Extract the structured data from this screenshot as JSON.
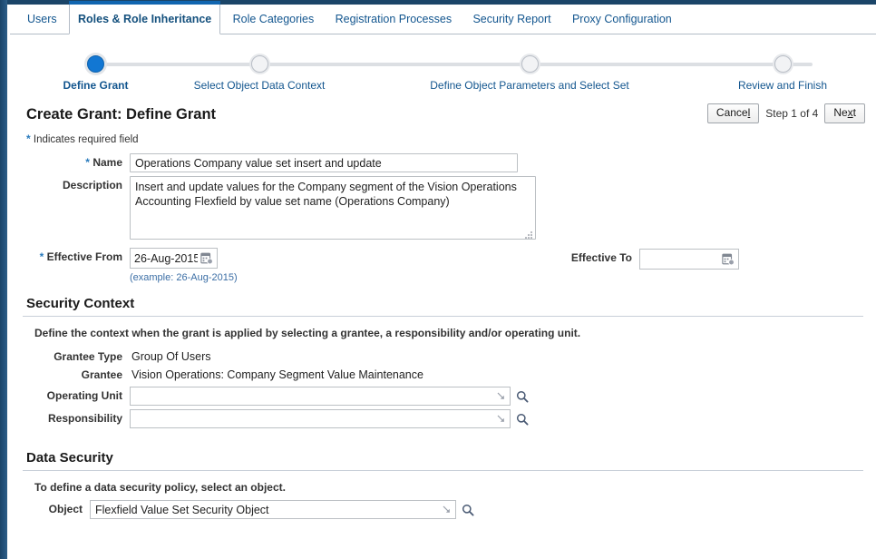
{
  "tabs": [
    {
      "label": "Users",
      "active": false
    },
    {
      "label": "Roles & Role Inheritance",
      "active": true
    },
    {
      "label": "Role Categories",
      "active": false
    },
    {
      "label": "Registration Processes",
      "active": false
    },
    {
      "label": "Security Report",
      "active": false
    },
    {
      "label": "Proxy Configuration",
      "active": false
    }
  ],
  "train": {
    "steps": [
      {
        "label": "Define Grant",
        "active": true
      },
      {
        "label": "Select Object Data Context",
        "active": false
      },
      {
        "label": "Define Object Parameters and Select Set",
        "active": false
      },
      {
        "label": "Review and Finish",
        "active": false
      }
    ]
  },
  "header": {
    "title": "Create Grant: Define Grant",
    "cancel_label": "Cancel",
    "cancel_pre": "Cance",
    "cancel_key": "l",
    "step_count": "Step 1 of 4",
    "next_label": "Next",
    "next_pre": "Ne",
    "next_key": "x",
    "next_post": "t",
    "required_note": "Indicates required field",
    "required_marker": "*"
  },
  "form": {
    "name_label": "Name",
    "name_value": "Operations Company value set insert and update",
    "description_label": "Description",
    "description_value": "Insert and update values for the Company segment of the Vision Operations Accounting Flexfield by value set name (Operations Company)",
    "effective_from_label": "Effective From",
    "effective_from_value": "26-Aug-2015",
    "effective_from_hint": "(example: 26-Aug-2015)",
    "effective_to_label": "Effective To",
    "effective_to_value": ""
  },
  "security_context": {
    "title": "Security Context",
    "description": "Define the context when the grant is applied by selecting a grantee, a responsibility and/or operating unit.",
    "grantee_type_label": "Grantee Type",
    "grantee_type_value": "Group Of Users",
    "grantee_label": "Grantee",
    "grantee_value": "Vision Operations: Company Segment Value Maintenance",
    "operating_unit_label": "Operating Unit",
    "operating_unit_value": "",
    "responsibility_label": "Responsibility",
    "responsibility_value": ""
  },
  "data_security": {
    "title": "Data Security",
    "description": "To define a data security policy, select an object.",
    "object_label": "Object",
    "object_value": "Flexfield Value Set Security Object"
  },
  "colors": {
    "chrome_navy": "#1b4568",
    "tab_accent": "#1166b0",
    "link_blue": "#13568f",
    "active_step": "#1277d3",
    "required_star": "#2a7bbd"
  }
}
